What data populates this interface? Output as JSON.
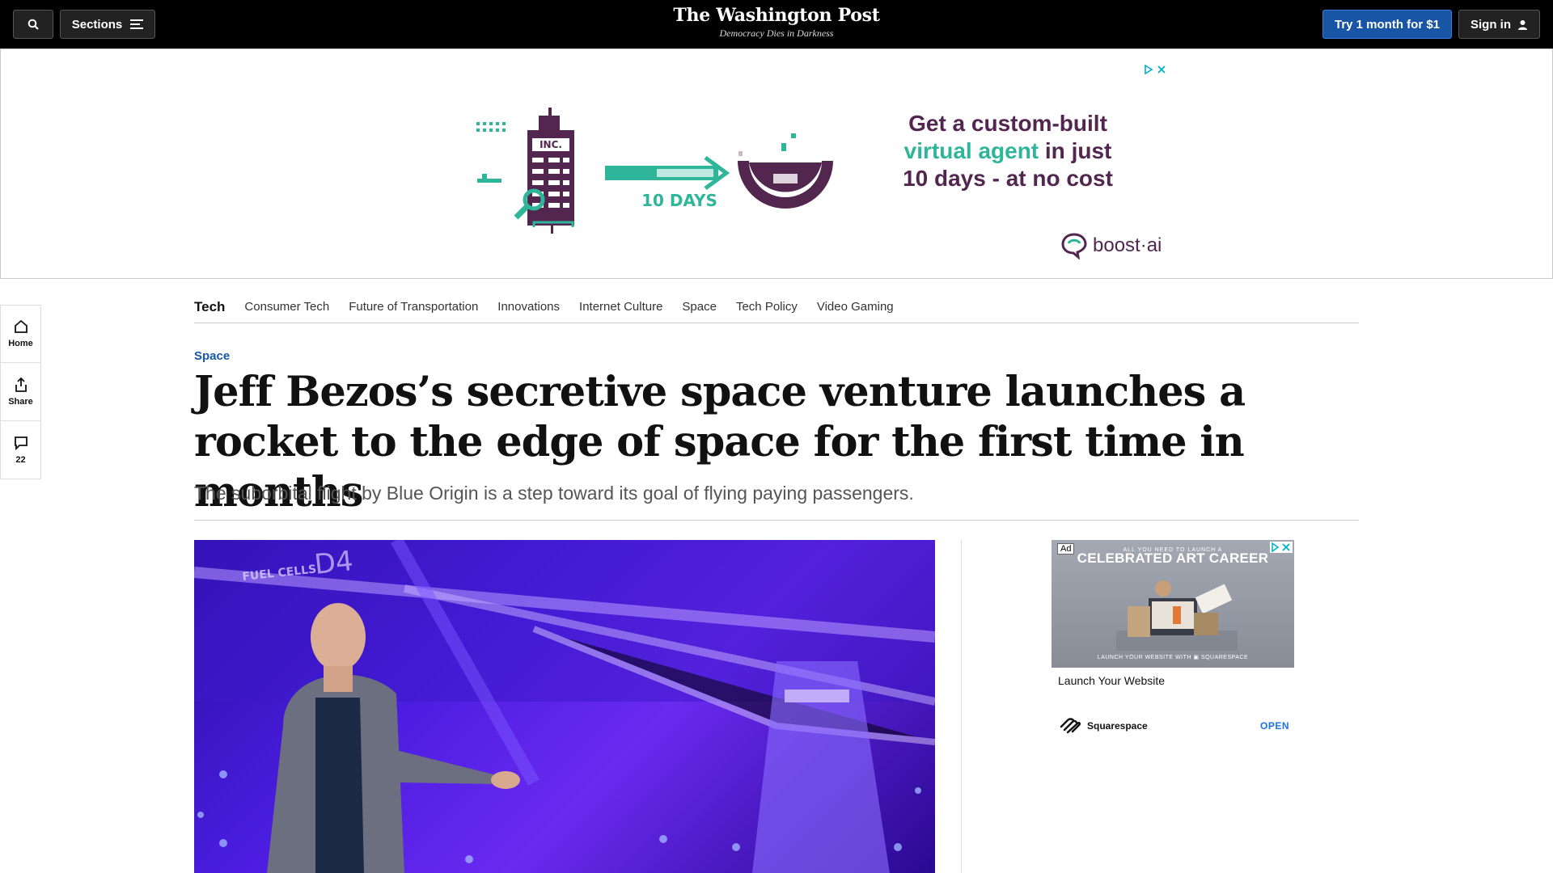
{
  "header": {
    "sections_label": "Sections",
    "logo_name": "The Washington Post",
    "logo_tagline": "Democracy Dies in Darkness",
    "subscribe_label": "Try 1 month for $1",
    "signin_label": "Sign in"
  },
  "banner_ad": {
    "illus_label": "INC.",
    "illus_days": "10 DAYS",
    "line1": "Get a custom-built",
    "line2_highlight": "virtual agent",
    "line2_rest": " in just",
    "line3": "10 days - at no cost",
    "brand": "boost·ai",
    "colors": {
      "purple": "#52264f",
      "teal": "#2eb59a"
    }
  },
  "rail": {
    "home_label": "Home",
    "share_label": "Share",
    "comments_count": "22"
  },
  "section_nav": {
    "current": "Tech",
    "items": [
      "Consumer Tech",
      "Future of Transportation",
      "Innovations",
      "Internet Culture",
      "Space",
      "Tech Policy",
      "Video Gaming"
    ]
  },
  "article": {
    "kicker": "Space",
    "headline": "Jeff Bezos’s secretive space venture launches a rocket to the edge of space for the first time in months",
    "subheadline": "The suborbital flight by Blue Origin is a step toward its goal of flying paying passengers.",
    "photo_text": "FUEL CELLS",
    "photo_code": "D4"
  },
  "side_ad": {
    "ad_label": "Ad",
    "top_small": "ALL YOU NEED TO LAUNCH A",
    "headline": "CELEBRATED ART CAREER",
    "bottom_small": "LAUNCH YOUR WEBSITE WITH ▣ SQUARESPACE",
    "caption": "Launch Your Website",
    "brand": "Squarespace",
    "cta": "OPEN"
  },
  "accent_color": "#1955a5"
}
